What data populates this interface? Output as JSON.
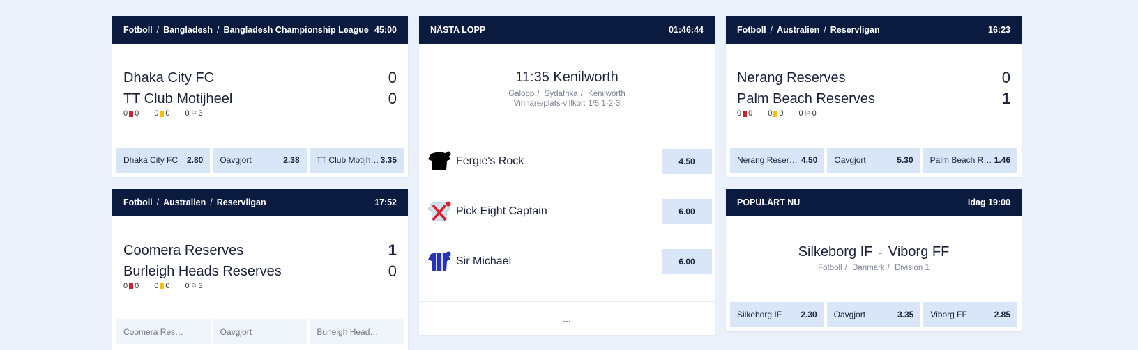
{
  "matches": [
    {
      "crumbs": [
        "Fotboll",
        "Bangladesh",
        "Bangladesh Championship League"
      ],
      "time": "45:00",
      "home": "Dhaka City FC",
      "away": "TT Club Motijheel",
      "home_score": "0",
      "away_score": "0",
      "home_bold": false,
      "away_bold": false,
      "stats": [
        {
          "home": "0",
          "away": "0",
          "icon": "red-card-icon"
        },
        {
          "home": "0",
          "away": "0",
          "icon": "yellow-card-icon"
        },
        {
          "home": "0",
          "away": "3",
          "icon": "corner-flag-icon"
        }
      ],
      "odds": [
        {
          "label": "Dhaka City FC",
          "value": "2.80"
        },
        {
          "label": "Oavgjort",
          "value": "2.38"
        },
        {
          "label": "TT Club Motijheel",
          "value": "3.35"
        }
      ],
      "disabled": false
    },
    {
      "crumbs": [
        "Fotboll",
        "Australien",
        "Reservligan"
      ],
      "time": "16:23",
      "home": "Nerang Reserves",
      "away": "Palm Beach Reserves",
      "home_score": "0",
      "away_score": "1",
      "home_bold": false,
      "away_bold": true,
      "stats": [
        {
          "home": "0",
          "away": "0",
          "icon": "red-card-icon"
        },
        {
          "home": "0",
          "away": "0",
          "icon": "yellow-card-icon"
        },
        {
          "home": "0",
          "away": "0",
          "icon": "corner-flag-icon"
        }
      ],
      "odds": [
        {
          "label": "Nerang Reserves",
          "value": "4.50"
        },
        {
          "label": "Oavgjort",
          "value": "5.30"
        },
        {
          "label": "Palm Beach Reserves",
          "value": "1.46"
        }
      ],
      "disabled": false
    },
    {
      "crumbs": [
        "Fotboll",
        "Australien",
        "Reservligan"
      ],
      "time": "17:52",
      "home": "Coomera Reserves",
      "away": "Burleigh Heads Reserves",
      "home_score": "1",
      "away_score": "0",
      "home_bold": true,
      "away_bold": false,
      "stats": [
        {
          "home": "0",
          "away": "0",
          "icon": "red-card-icon"
        },
        {
          "home": "0",
          "away": "0",
          "icon": "yellow-card-icon"
        },
        {
          "home": "0",
          "away": "3",
          "icon": "corner-flag-icon"
        }
      ],
      "odds": [
        {
          "label": "Coomera Reserves",
          "value": ""
        },
        {
          "label": "Oavgjort",
          "value": ""
        },
        {
          "label": "Burleigh Heads Reserves",
          "value": ""
        }
      ],
      "disabled": true
    }
  ],
  "race": {
    "header": "NÄSTA LOPP",
    "countdown": "01:46:44",
    "title": "11:35 Kenilworth",
    "crumbs": [
      "Galopp",
      "Sydafrika",
      "Kenilworth"
    ],
    "terms": "Vinnare/plats-villkor: 1/5 1-2-3",
    "runners": [
      {
        "name": "Fergie's Rock",
        "odds": "4.50",
        "silk_icon": "black-jersey-silk-icon"
      },
      {
        "name": "Pick Eight Captain",
        "odds": "6.00",
        "silk_icon": "red-cross-silk-icon"
      },
      {
        "name": "Sir Michael",
        "odds": "6.00",
        "silk_icon": "blue-jersey-silk-icon"
      }
    ],
    "more": "..."
  },
  "popular": {
    "header": "POPULÄRT NU",
    "time": "Idag 19:00",
    "home": "Silkeborg IF",
    "dash": "-",
    "away": "Viborg FF",
    "crumbs": [
      "Fotboll",
      "Danmark",
      "Division 1"
    ],
    "odds": [
      {
        "label": "Silkeborg IF",
        "value": "2.30"
      },
      {
        "label": "Oavgjort",
        "value": "3.35"
      },
      {
        "label": "Viborg FF",
        "value": "2.85"
      }
    ]
  }
}
